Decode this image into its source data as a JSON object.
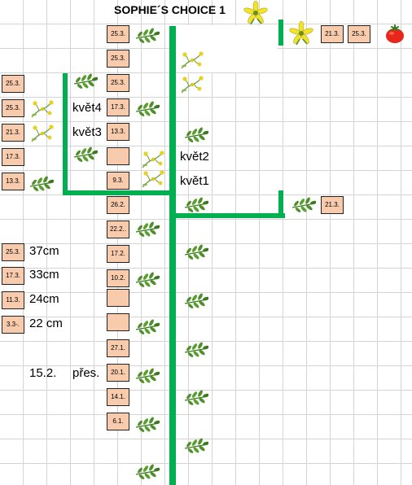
{
  "title": "SOPHIE´S CHOICE 1",
  "dates": {
    "d1": "25.3.",
    "d2": "25.3.",
    "d3": "25.3.",
    "d4": "17.3.",
    "d5": "13.3.",
    "d6": "",
    "d7": "9.3.",
    "d8": "26.2.",
    "d9": "22.2..",
    "d10": "17.2.",
    "d11": "10.2.",
    "d12": "",
    "d13": "",
    "d14": "27.1.",
    "d15": "20.1.",
    "d16": "14.1.",
    "d17": "6.1.",
    "l1": "25.3.",
    "l2": "25.3.",
    "l3": "21.3.",
    "l4": "17.3.",
    "l5": "13.3.",
    "l6": "25.3.",
    "l7": "17.3.",
    "l8": "11.3.",
    "l9": "3.3-.",
    "r1": "21.3.",
    "r2": "25.3.",
    "r3": "21.3."
  },
  "labels": {
    "kvet4": "květ4",
    "kvet3": "květ3",
    "kvet2": "květ2",
    "kvet1": "květ1",
    "h37": "37cm",
    "h33": "33cm",
    "h24": "24cm",
    "h22": "22 cm",
    "date_152": "15.2.",
    "pres": "přes."
  },
  "colors": {
    "stem": "#00b050",
    "date_fill": "#f8cbad",
    "grid": "#d4d4d4"
  },
  "icons": [
    "leaf-icon",
    "flower-bud-icon",
    "open-flower-icon",
    "tomato-icon"
  ]
}
